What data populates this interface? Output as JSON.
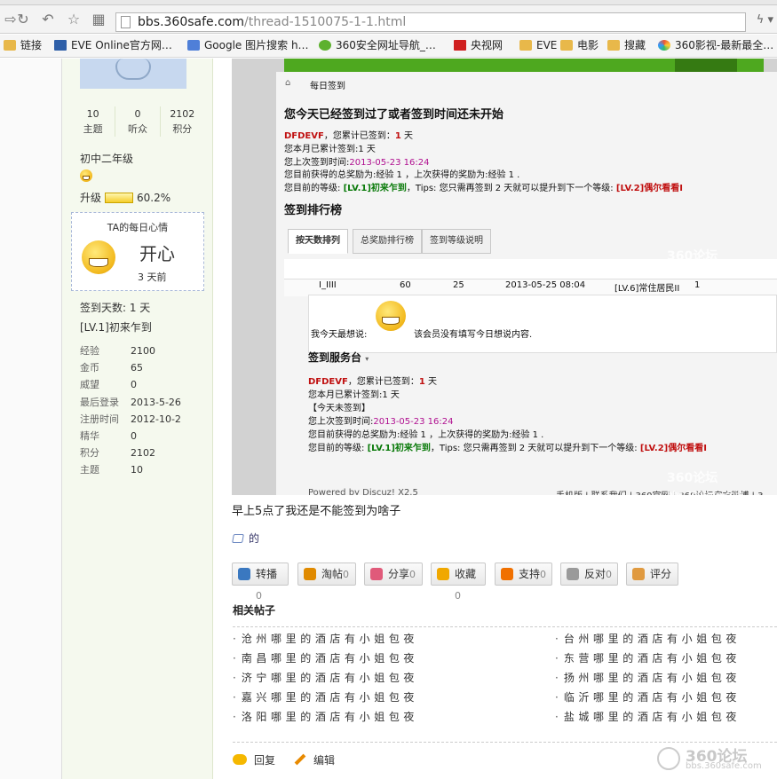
{
  "browser": {
    "url_domain": "bbs.360safe.com",
    "url_path": "/thread-1510075-1-1.html",
    "bookmarks": [
      {
        "label": "链接",
        "icon": "folder-icon"
      },
      {
        "label": "EVE Online官方网…",
        "icon": "page-icon"
      },
      {
        "label": "Google 图片搜索 h…",
        "icon": "google-icon"
      },
      {
        "label": "360安全网址导航_…",
        "icon": "360-icon"
      },
      {
        "label": "央视网",
        "icon": "cctv-icon"
      },
      {
        "label": "EVE",
        "icon": "folder-icon"
      },
      {
        "label": "电影",
        "icon": "folder-icon"
      },
      {
        "label": "搜藏",
        "icon": "folder-icon"
      },
      {
        "label": "360影视-最新最全…",
        "icon": "360video-icon"
      }
    ]
  },
  "sidebar": {
    "stats": [
      {
        "num": "10",
        "label": "主题"
      },
      {
        "num": "0",
        "label": "听众"
      },
      {
        "num": "2102",
        "label": "积分"
      }
    ],
    "rank": "初中二年级",
    "upgrade_label": "升级",
    "upgrade_percent": "60.2%",
    "upgrade_fraction": 0.602,
    "mood_title": "TA的每日心情",
    "mood": "开心",
    "mood_ago": "3 天前",
    "checkin_days": "签到天数: 1 天",
    "level": "[LV.1]初来乍到",
    "info": [
      {
        "k": "经验",
        "v": "2100"
      },
      {
        "k": "金币",
        "v": "65"
      },
      {
        "k": "威望",
        "v": "0"
      },
      {
        "k": "最后登录",
        "v": "2013-5-26"
      },
      {
        "k": "注册时间",
        "v": "2012-10-2"
      },
      {
        "k": "精华",
        "v": "0"
      },
      {
        "k": "积分",
        "v": "2102"
      },
      {
        "k": "主题",
        "v": "10"
      }
    ]
  },
  "shot": {
    "breadcrumb": "每日签到",
    "headline": "您今天已经签到过了或者签到时间还未开始",
    "user": "DFDEVF",
    "line1": "，您累计已签到：",
    "line1_num": "1",
    "line1_unit": "天",
    "line2": "您本月已累计签到:1 天",
    "line3": "您上次签到时间:",
    "line3_time": "2013-05-23 16:24",
    "line4": "您目前获得的总奖励为:经验 1 ，上次获得的奖励为:经验 1 .",
    "line5_a": "您目前的等级:",
    "line5_lv": "[LV.1]初来乍到",
    "line5_b": "，Tips: 您只需再签到 2 天就可以提升到下一个等级:",
    "line5_next": "[LV.2]偶尔看看I",
    "rank_title": "签到排行榜",
    "tabs": [
      "按天数排列",
      "总奖励排行榜",
      "签到等级说明"
    ],
    "row": [
      "I_IIII",
      "60",
      "25",
      "2013-05-25 08:04",
      "[LV.6]常住居民II",
      "1"
    ],
    "says_label": "我今天最想说:",
    "says_text": "该会员没有填写今日想说内容.",
    "service_title": "签到服务台",
    "today_not": "【今天未签到】",
    "powered": "Powered by Discuz! X2.5",
    "footer_links": "手机版 | 联系我们 | 360官网 | 360论坛官方微博 | 3",
    "wm_a": "360论坛",
    "wm_b": "bbs.360safe.com"
  },
  "post": {
    "caption": "早上5点了我还是不能签到为啥子",
    "tag": "的"
  },
  "actions": [
    {
      "label": "转播",
      "count": "0",
      "icon": "share-arrow-icon",
      "color": "#3a78c0"
    },
    {
      "label": "淘帖",
      "count": "0",
      "icon": "collect-box-icon",
      "color": "#e08a00"
    },
    {
      "label": "分享",
      "count": "0",
      "icon": "heart-icon",
      "color": "#e05a7a"
    },
    {
      "label": "收藏",
      "count": "0",
      "icon": "star-icon",
      "color": "#f0a800"
    },
    {
      "label": "支持",
      "count": "0",
      "icon": "up-arrow-icon",
      "color": "#f07000"
    },
    {
      "label": "反对",
      "count": "0",
      "icon": "down-arrow-icon",
      "color": "#9a9a9a"
    },
    {
      "label": "评分",
      "count": "",
      "icon": "thumb-icon",
      "color": "#e09a40"
    }
  ],
  "related": {
    "title": "相关帖子",
    "left": [
      "沧州哪里的酒店有小姐包夜",
      "南昌哪里的酒店有小姐包夜",
      "济宁哪里的酒店有小姐包夜",
      "嘉兴哪里的酒店有小姐包夜",
      "洛阳哪里的酒店有小姐包夜"
    ],
    "right": [
      "台州哪里的酒店有小姐包夜",
      "东营哪里的酒店有小姐包夜",
      "扬州哪里的酒店有小姐包夜",
      "临沂哪里的酒店有小姐包夜",
      "盐城哪里的酒店有小姐包夜"
    ]
  },
  "footer": {
    "reply": "回复",
    "edit": "编辑",
    "wm_a": "360论坛",
    "wm_b": "bbs.360safe.com"
  }
}
